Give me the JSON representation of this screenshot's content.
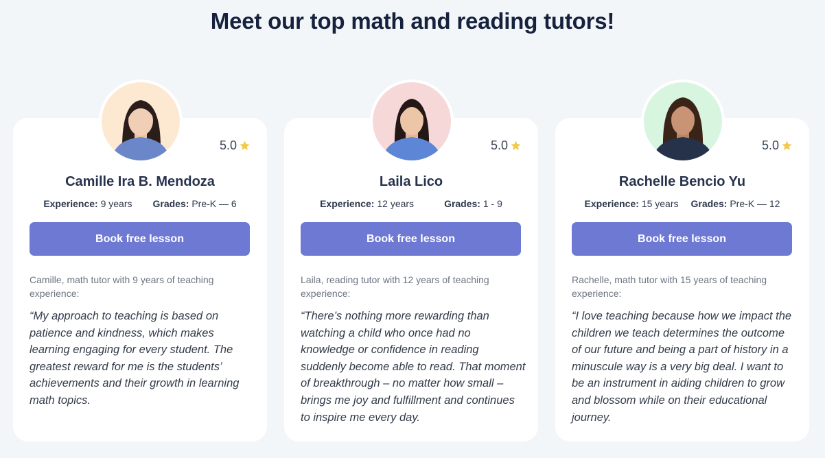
{
  "heading": "Meet our top math and reading tutors!",
  "labels": {
    "experience": "Experience:",
    "grades": "Grades:"
  },
  "colors": {
    "button": "#6e79d4",
    "star": "#f2c94c",
    "avatar_bg_1": "#fde9d2",
    "avatar_bg_2": "#f6d8d8",
    "avatar_bg_3": "#d7f5df"
  },
  "tutors": [
    {
      "name": "Camille Ira B. Mendoza",
      "rating": "5.0",
      "experience": "9 years",
      "grades": "Pre-K — 6",
      "button": "Book free lesson",
      "intro": "Camille, math tutor with 9 years of teaching experience:",
      "quote": "“My approach to teaching is based on patience and kindness, which makes learning engaging for every student. The greatest reward for me is the students’ achievements and their growth in learning math topics."
    },
    {
      "name": "Laila Lico",
      "rating": "5.0",
      "experience": "12 years",
      "grades": "1 - 9",
      "button": "Book free lesson",
      "intro": "Laila, reading tutor with 12 years of teaching experience:",
      "quote": "“There’s nothing more rewarding than watching a child who once had no knowledge or confidence in reading suddenly become able to read. That moment of breakthrough – no matter how small – brings me joy and fulfillment and continues to inspire me every day."
    },
    {
      "name": "Rachelle Bencio Yu",
      "rating": "5.0",
      "experience": "15 years",
      "grades": "Pre-K — 12",
      "button": "Book free lesson",
      "intro": "Rachelle, math tutor with 15 years of teaching experience:",
      "quote": "“I love teaching because how we impact the children we teach determines the outcome of our future and being a part of history in a minuscule way is a very big deal. I want to be an instrument in aiding children to grow and blossom while on their educational journey."
    }
  ]
}
